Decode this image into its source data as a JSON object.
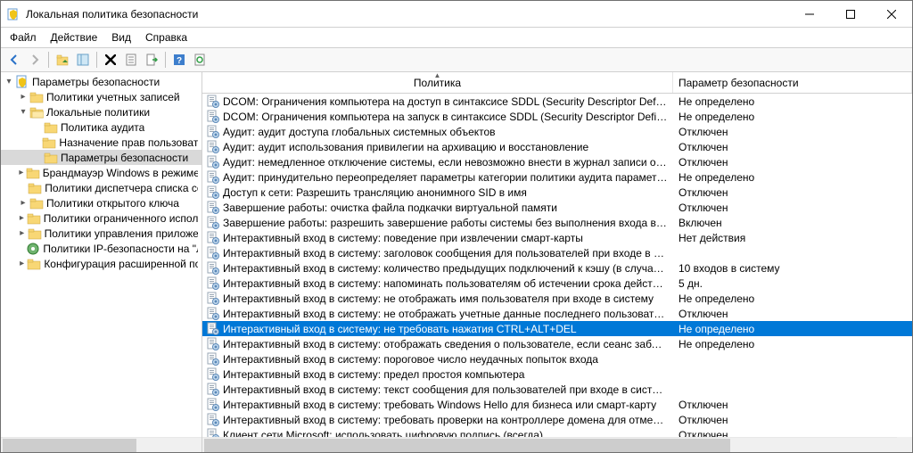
{
  "window": {
    "title": "Локальная политика безопасности"
  },
  "menu": {
    "file": "Файл",
    "action": "Действие",
    "view": "Вид",
    "help": "Справка"
  },
  "tree": {
    "root": "Параметры безопасности",
    "n0": "Политики учетных записей",
    "n1": "Локальные политики",
    "n1a": "Политика аудита",
    "n1b": "Назначение прав пользователя",
    "n1c": "Параметры безопасности",
    "n2": "Брандмауэр Windows в режиме повышенной",
    "n3": "Политики диспетчера списка сетей",
    "n4": "Политики открытого ключа",
    "n5": "Политики ограниченного использования",
    "n6": "Политики управления приложениями",
    "n7": "Политики IP-безопасности на \"Локальный",
    "n8": "Конфигурация расширенной политики"
  },
  "columns": {
    "name": "Политика",
    "value": "Параметр безопасности"
  },
  "rows": [
    {
      "n": "DCOM: Ограничения компьютера на доступ в синтаксисе SDDL (Security Descriptor Definition Language)",
      "v": "Не определено"
    },
    {
      "n": "DCOM: Ограничения компьютера на запуск в синтаксисе SDDL (Security Descriptor Definition Language)",
      "v": "Не определено"
    },
    {
      "n": "Аудит: аудит доступа глобальных системных объектов",
      "v": "Отключен"
    },
    {
      "n": "Аудит: аудит использования привилегии на архивацию и восстановление",
      "v": "Отключен"
    },
    {
      "n": "Аудит: немедленное отключение системы, если невозможно внести в журнал записи об аудите безо...",
      "v": "Отключен"
    },
    {
      "n": "Аудит: принудительно переопределяет параметры категории политики аудита параметрами подкатег...",
      "v": "Не определено"
    },
    {
      "n": "Доступ к сети: Разрешить трансляцию анонимного SID в имя",
      "v": "Отключен"
    },
    {
      "n": "Завершение работы: очистка файла подкачки виртуальной памяти",
      "v": "Отключен"
    },
    {
      "n": "Завершение работы: разрешить завершение работы системы без выполнения входа в систему",
      "v": "Включен"
    },
    {
      "n": "Интерактивный вход в систему: поведение при извлечении смарт-карты",
      "v": "Нет действия"
    },
    {
      "n": "Интерактивный вход в систему: заголовок сообщения для пользователей при входе в систему",
      "v": ""
    },
    {
      "n": "Интерактивный вход в систему: количество предыдущих подключений к кэшу (в случае отсутствия д...",
      "v": "10 входов в систему"
    },
    {
      "n": "Интерактивный вход в систему: напоминать пользователям об истечении срока действия пароля зар...",
      "v": "5 дн."
    },
    {
      "n": "Интерактивный вход в систему: не отображать имя пользователя при входе в систему",
      "v": "Не определено"
    },
    {
      "n": "Интерактивный вход в систему: не отображать учетные данные последнего пользователя",
      "v": "Отключен"
    },
    {
      "n": "Интерактивный вход в систему: не требовать нажатия CTRL+ALT+DEL",
      "v": "Не определено",
      "sel": true
    },
    {
      "n": "Интерактивный вход в систему: отображать сведения о пользователе, если сеанс заблокирован.",
      "v": "Не определено"
    },
    {
      "n": "Интерактивный вход в систему: пороговое число неудачных попыток входа",
      "v": ""
    },
    {
      "n": "Интерактивный вход в систему: предел простоя компьютера",
      "v": ""
    },
    {
      "n": "Интерактивный вход в систему: текст сообщения для пользователей при входе в систему",
      "v": ""
    },
    {
      "n": "Интерактивный вход в систему: требовать Windows Hello для бизнеса или смарт-карту",
      "v": "Отключен"
    },
    {
      "n": "Интерактивный вход в систему: требовать проверки на контроллере домена для отмены блокировки ...",
      "v": "Отключен"
    },
    {
      "n": "Клиент сети Microsoft: использовать цифровую подпись (всегда)",
      "v": "Отключен"
    }
  ]
}
